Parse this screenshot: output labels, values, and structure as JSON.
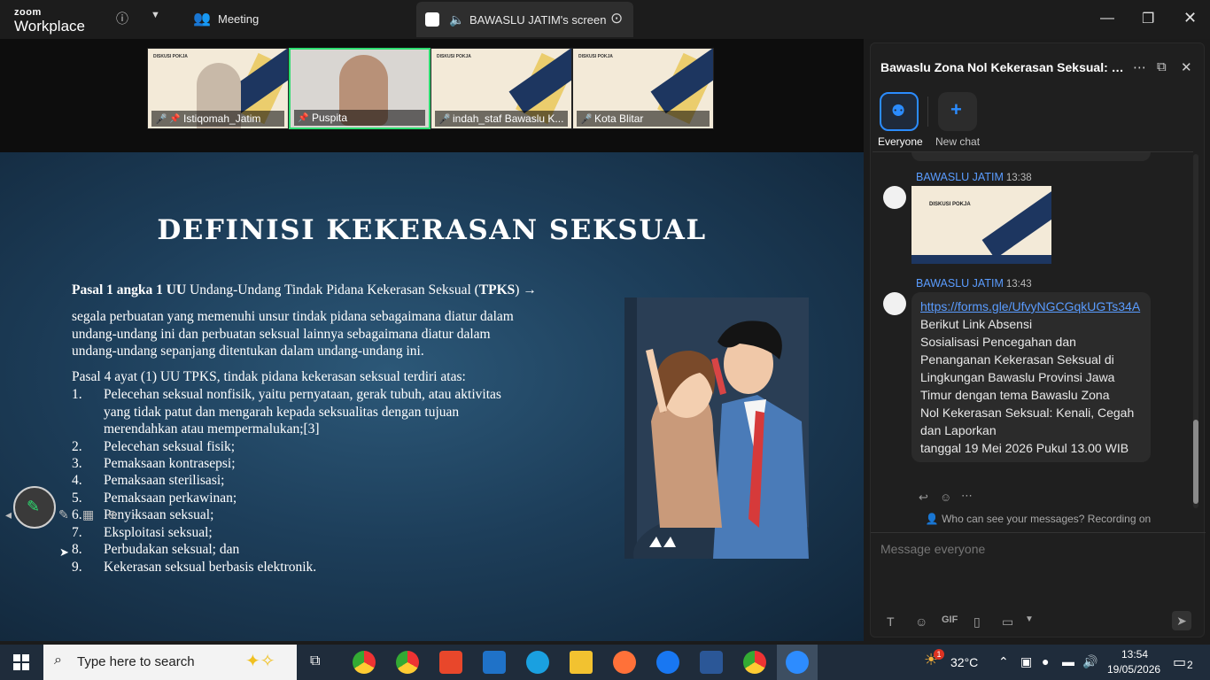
{
  "app": {
    "logo_top": "zoom",
    "logo_bottom": "Workplace"
  },
  "topbar": {
    "meeting_label": "Meeting",
    "share_label": "BAWASLU JATIM's screen"
  },
  "participants": [
    {
      "name": "Istiqomah_Jatim"
    },
    {
      "name": "Puspita"
    },
    {
      "name": "indah_staf Bawaslu K..."
    },
    {
      "name": "Kota Blitar"
    }
  ],
  "thumb_mini_text": "DISKUSI POKJA",
  "slide": {
    "title": "DEFINISI KEKERASAN SEKSUAL",
    "intro_bold1": "Pasal 1 angka 1 UU",
    "intro_mid": " Undang-Undang Tindak Pidana Kekerasan Seksual (",
    "intro_bold2": "TPKS",
    "intro_end": ") →",
    "def_lines": [
      "segala perbuatan yang memenuhi unsur tindak pidana sebagaimana diatur dalam",
      "undang-undang ini dan perbuatan seksual lainnya sebagaimana diatur dalam",
      "undang-undang sepanjang ditentukan dalam undang-undang ini."
    ],
    "pasal4": "Pasal 4 ayat (1) UU TPKS, tindak pidana kekerasan seksual terdiri atas:",
    "items": [
      {
        "num": "1.",
        "lines": [
          "Pelecehan seksual nonfisik, yaitu pernyataan, gerak tubuh, atau aktivitas",
          "yang tidak patut dan mengarah kepada seksualitas dengan tujuan",
          "merendahkan atau mempermalukan;[3]"
        ]
      },
      {
        "num": "2.",
        "lines": [
          "Pelecehan seksual fisik;"
        ]
      },
      {
        "num": "3.",
        "lines": [
          "Pemaksaan kontrasepsi;"
        ]
      },
      {
        "num": "4.",
        "lines": [
          "Pemaksaan sterilisasi;"
        ]
      },
      {
        "num": "5.",
        "lines": [
          "Pemaksaan perkawinan;"
        ]
      },
      {
        "num": "6.",
        "lines": [
          "Penyiksaan seksual;"
        ]
      },
      {
        "num": "7.",
        "lines": [
          "Eksploitasi seksual;"
        ]
      },
      {
        "num": "8.",
        "lines": [
          "Perbudakan seksual; dan"
        ]
      },
      {
        "num": "9.",
        "lines": [
          "Kekerasan seksual berbasis elektronik."
        ]
      }
    ]
  },
  "chat": {
    "title": "Bawaslu Zona Nol Kekerasan Seksual: Kena...",
    "tab_everyone": "Everyone",
    "tab_new": "New chat",
    "messages": [
      {
        "sender": "BAWASLU JATIM",
        "time": "13:38"
      },
      {
        "sender": "BAWASLU JATIM",
        "time": "13:43",
        "link": "https://forms.gle/UfvyNGCGqkUGTs34A",
        "lines": [
          "Berikut Link Absensi",
          "Sosialisasi Pencegahan dan",
          "Penanganan Kekerasan Seksual di",
          "Lingkungan Bawaslu Provinsi Jawa",
          "Timur dengan tema Bawaslu Zona",
          "Nol Kekerasan Seksual: Kenali, Cegah",
          "dan Laporkan",
          "tanggal 19 Mei 2026 Pukul 13.00 WIB"
        ]
      }
    ],
    "who_can_see": "Who can see your messages? Recording on",
    "input_placeholder": "Message everyone"
  },
  "taskbar": {
    "search_placeholder": "Type here to search",
    "temperature": "32°C",
    "time": "13:54",
    "date": "19/05/2026",
    "notifications": "2",
    "weather_badge": "1"
  },
  "colors": {
    "accent": "#2b8cff",
    "active_speaker": "#2ddc70",
    "link": "#5a9cff"
  }
}
